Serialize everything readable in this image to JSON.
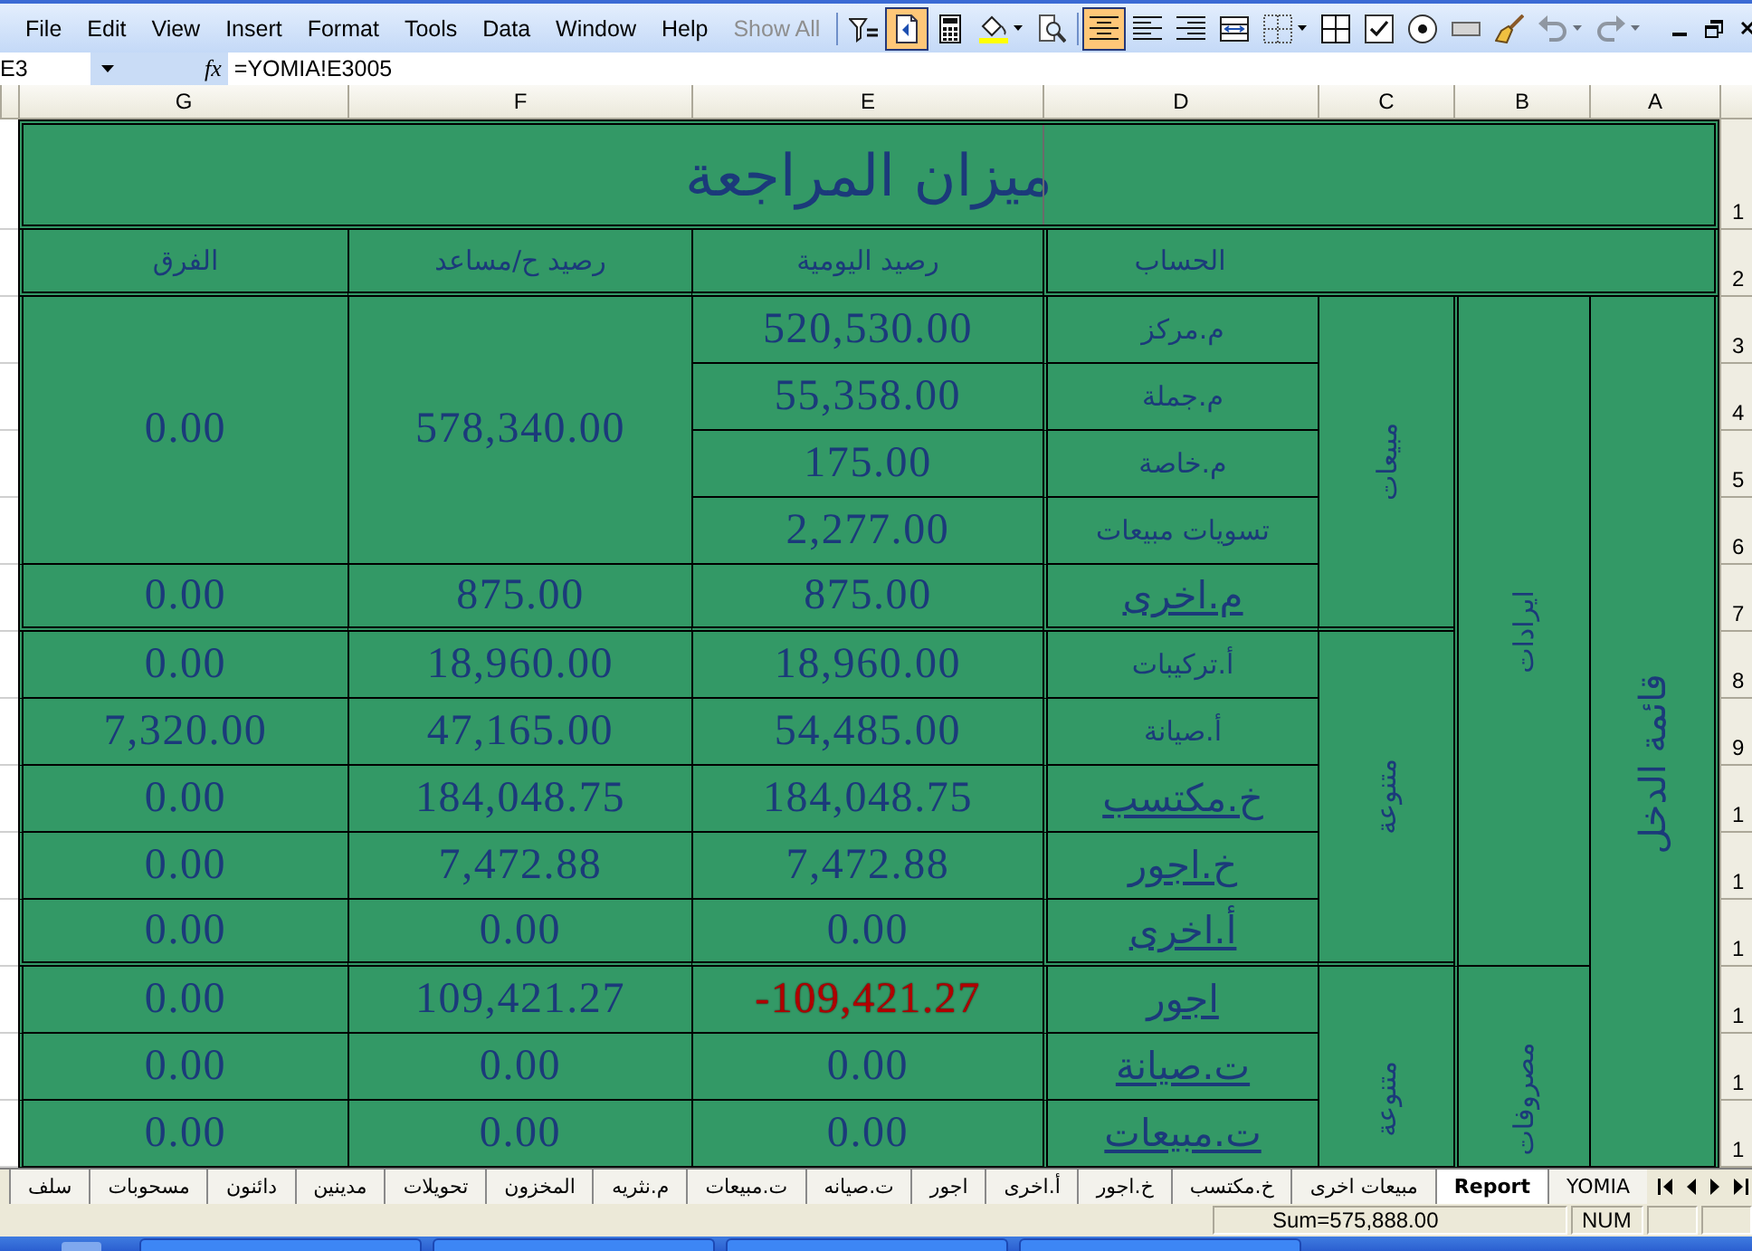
{
  "menu_bar": {
    "items": [
      {
        "label": "Show All",
        "disabled": true
      },
      {
        "label": "Help",
        "disabled": false
      },
      {
        "label": "Window",
        "disabled": false
      },
      {
        "label": "Data",
        "disabled": false
      },
      {
        "label": "Tools",
        "disabled": false
      },
      {
        "label": "Format",
        "disabled": false
      },
      {
        "label": "Insert",
        "disabled": false
      },
      {
        "label": "View",
        "disabled": false
      },
      {
        "label": "Edit",
        "disabled": false
      },
      {
        "label": "File",
        "disabled": false
      }
    ]
  },
  "toolbar": {
    "buttons": [
      {
        "pressed": false,
        "disabled": false
      },
      {
        "pressed": true,
        "disabled": false
      },
      {
        "pressed": false,
        "disabled": false
      },
      {
        "pressed": false,
        "disabled": false
      },
      {
        "pressed": false,
        "disabled": false
      },
      {
        "pressed": true,
        "disabled": false
      },
      {
        "pressed": false,
        "disabled": false
      },
      {
        "pressed": false,
        "disabled": false
      },
      {
        "pressed": false,
        "disabled": false
      },
      {
        "pressed": false,
        "disabled": false
      },
      {
        "pressed": false,
        "disabled": false
      },
      {
        "pressed": false,
        "disabled": false
      },
      {
        "pressed": false,
        "disabled": false
      },
      {
        "pressed": false,
        "disabled": false
      },
      {
        "pressed": false,
        "disabled": false
      },
      {
        "pressed": false,
        "disabled": true
      },
      {
        "pressed": false,
        "disabled": true
      }
    ]
  },
  "formula_bar": {
    "name_box": "E3",
    "function_button": "fx",
    "formula": "=YOMIA!E3005"
  },
  "column_headers": [
    "A",
    "B",
    "C",
    "D",
    "E",
    "F",
    "G"
  ],
  "row_headers": [
    "1",
    "2",
    "3",
    "4",
    "5",
    "6",
    "7",
    "8",
    "9",
    "1",
    "1",
    "1",
    "1",
    "1",
    "1"
  ],
  "sheet": {
    "title": "ميزان المراجعة",
    "columns": [
      "الحساب",
      "رصيد اليومية",
      "رصيد ح/مساعد",
      "الفرق"
    ],
    "statement": "قائمة الدخل",
    "sections": [
      {
        "label": "ايرادات",
        "groups": [
          {
            "label": "مبيعات",
            "entries": [
              {
                "accounts": [
                  {
                    "name": "م.مركز",
                    "kind": "text",
                    "journal": "520,530.00",
                    "negative": false
                  },
                  {
                    "name": "م.جملة",
                    "kind": "text",
                    "journal": "55,358.00",
                    "negative": false
                  },
                  {
                    "name": "م.خاصة",
                    "kind": "text",
                    "journal": "175.00",
                    "negative": false
                  },
                  {
                    "name": "تسويات مبيعات",
                    "kind": "text",
                    "journal": "2,277.00",
                    "negative": false
                  }
                ],
                "ledger": "578,340.00",
                "difference": "0.00"
              },
              {
                "accounts": [
                  {
                    "name": "م.اخرى",
                    "kind": "link",
                    "journal": "875.00",
                    "negative": false
                  }
                ],
                "ledger": "875.00",
                "difference": "0.00"
              }
            ]
          },
          {
            "label": "متنوعة",
            "entries": [
              {
                "accounts": [
                  {
                    "name": "أ.تركيبات",
                    "kind": "text",
                    "journal": "18,960.00",
                    "negative": false
                  }
                ],
                "ledger": "18,960.00",
                "difference": "0.00"
              },
              {
                "accounts": [
                  {
                    "name": "أ.صيانة",
                    "kind": "text",
                    "journal": "54,485.00",
                    "negative": false
                  }
                ],
                "ledger": "47,165.00",
                "difference": "7,320.00"
              },
              {
                "accounts": [
                  {
                    "name": "خ.مكتسب",
                    "kind": "link",
                    "journal": "184,048.75",
                    "negative": false
                  }
                ],
                "ledger": "184,048.75",
                "difference": "0.00"
              },
              {
                "accounts": [
                  {
                    "name": "خ.اجور",
                    "kind": "link",
                    "journal": "7,472.88",
                    "negative": false
                  }
                ],
                "ledger": "7,472.88",
                "difference": "0.00"
              },
              {
                "accounts": [
                  {
                    "name": "أ.اخرى",
                    "kind": "link",
                    "journal": "0.00",
                    "negative": false
                  }
                ],
                "ledger": "0.00",
                "difference": "0.00"
              }
            ]
          }
        ]
      },
      {
        "label": "مصروفات",
        "groups": [
          {
            "label": "متنوعة",
            "entries": [
              {
                "accounts": [
                  {
                    "name": "اجور",
                    "kind": "link",
                    "journal": "-109,421.27",
                    "negative": true
                  }
                ],
                "ledger": "109,421.27",
                "difference": "0.00"
              },
              {
                "accounts": [
                  {
                    "name": "ت.صيانة",
                    "kind": "link",
                    "journal": "0.00",
                    "negative": false
                  }
                ],
                "ledger": "0.00",
                "difference": "0.00"
              },
              {
                "accounts": [
                  {
                    "name": "ت.مبيعات",
                    "kind": "link",
                    "journal": "0.00",
                    "negative": false
                  }
                ],
                "ledger": "0.00",
                "difference": "0.00"
              }
            ]
          }
        ]
      }
    ]
  },
  "sheet_tabs": [
    {
      "label": "YOMIA",
      "selected": false
    },
    {
      "label": "Report",
      "selected": true
    },
    {
      "label": "مبيعات اخرى",
      "selected": false
    },
    {
      "label": "خ.مكتسب",
      "selected": false
    },
    {
      "label": "خ.اجور",
      "selected": false
    },
    {
      "label": "أ.اخرى",
      "selected": false
    },
    {
      "label": "اجور",
      "selected": false
    },
    {
      "label": "ت.صيانه",
      "selected": false
    },
    {
      "label": "ت.مبيعات",
      "selected": false
    },
    {
      "label": "م.نثريه",
      "selected": false
    },
    {
      "label": "المخزون",
      "selected": false
    },
    {
      "label": "تحويلات",
      "selected": false
    },
    {
      "label": "مدينين",
      "selected": false
    },
    {
      "label": "دائنون",
      "selected": false
    },
    {
      "label": "مسحوبات",
      "selected": false
    },
    {
      "label": "سلف",
      "selected": false
    }
  ],
  "status_bar": {
    "sum": "Sum=575,888.00",
    "indicator": "NUM"
  }
}
